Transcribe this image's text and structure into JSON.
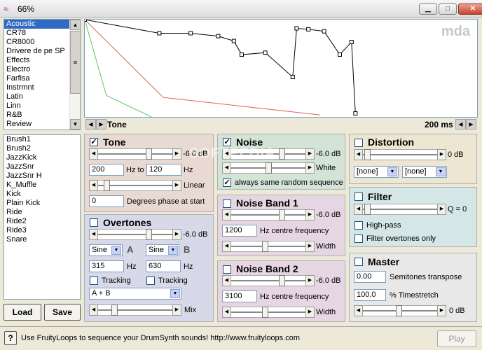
{
  "window": {
    "title": "66%",
    "min": "▁",
    "max": "□",
    "close": "✕"
  },
  "icons": {
    "app": "wave-icon"
  },
  "presets": {
    "items": [
      "Acoustic",
      "CR78",
      "CR8000",
      "Drivere de pe SP",
      "Effects",
      "Electro",
      "Farfisa",
      "Instrmnt",
      "Latin",
      "Linn",
      "R&B",
      "Review"
    ],
    "selected": 0
  },
  "samples": {
    "items": [
      "Brush1",
      "Brush2",
      "JazzKick",
      "JazzSnr",
      "JazzSnr H",
      "K_Muffle",
      "Kick",
      "Plain Kick",
      "Ride",
      "Ride2",
      "Ride3",
      "Snare"
    ]
  },
  "buttons": {
    "load": "Load",
    "save": "Save",
    "play": "Play",
    "help": "?"
  },
  "graph": {
    "logo": "mda",
    "label": "Tone",
    "time": "200 ms",
    "envelope": [
      [
        0,
        0
      ],
      [
        0.19,
        0.14
      ],
      [
        0.27,
        0.14
      ],
      [
        0.34,
        0.17
      ],
      [
        0.38,
        0.22
      ],
      [
        0.4,
        0.36
      ],
      [
        0.46,
        0.34
      ],
      [
        0.53,
        0.59
      ],
      [
        0.54,
        0.09
      ],
      [
        0.57,
        0.1
      ],
      [
        0.61,
        0.12
      ],
      [
        0.65,
        0.36
      ],
      [
        0.68,
        0.23
      ],
      [
        0.69,
        0.98
      ]
    ],
    "colors": {
      "line": "#000000",
      "green": "#55cc55",
      "red": "#e06050"
    }
  },
  "tone": {
    "title": "Tone",
    "checked": true,
    "level": "-6.0 dB",
    "f1": "200",
    "hz_to": "Hz to",
    "f2": "120",
    "hz": "Hz",
    "mode": "Linear",
    "phase": "0",
    "phase_label": "Degrees phase at start",
    "bg": "#e8d9d2"
  },
  "overtones": {
    "title": "Overtones",
    "checked": false,
    "level": "-6.0 dB",
    "wave_a": "Sine",
    "label_a": "A",
    "wave_b": "Sine",
    "label_b": "B",
    "f_a": "315",
    "f_b": "630",
    "hz": "Hz",
    "tracking": "Tracking",
    "mix_mode": "A + B",
    "mix": "Mix",
    "bg": "#d7d8e8"
  },
  "noise": {
    "title": "Noise",
    "checked": true,
    "level": "-6.0 dB",
    "white": "White",
    "always": "always same random sequence",
    "always_checked": true,
    "bg": "#d3e3d6"
  },
  "noise_band_1": {
    "title": "Noise Band 1",
    "checked": false,
    "level": "-6.0 dB",
    "freq": "1200",
    "freq_label": "Hz centre frequency",
    "width": "Width",
    "bg": "#e6d6e2"
  },
  "noise_band_2": {
    "title": "Noise Band 2",
    "checked": false,
    "level": "-6.0 dB",
    "freq": "3100",
    "freq_label": "Hz centre frequency",
    "width": "Width",
    "bg": "#e6d6e2"
  },
  "distortion": {
    "title": "Distortion",
    "checked": false,
    "level": "0 dB",
    "opt1": "[none]",
    "opt2": "[none]",
    "bg": "#ece6d2"
  },
  "filter": {
    "title": "Filter",
    "checked": false,
    "q": "Q = 0",
    "highpass": "High-pass",
    "overtones_only": "Filter overtones only",
    "bg": "#d4e6e6"
  },
  "master": {
    "title": "Master",
    "checked": false,
    "transpose": "0.00",
    "transpose_label": "Semitones transpose",
    "stretch": "100.0",
    "stretch_label": "% Timestretch",
    "level": "0 dB",
    "bg": "#e8e8e8"
  },
  "status": {
    "text": "Use FruityLoops to sequence your DrumSynth sounds!  http://www.fruityloops.com"
  },
  "watermark": "SOFTPEDIA"
}
